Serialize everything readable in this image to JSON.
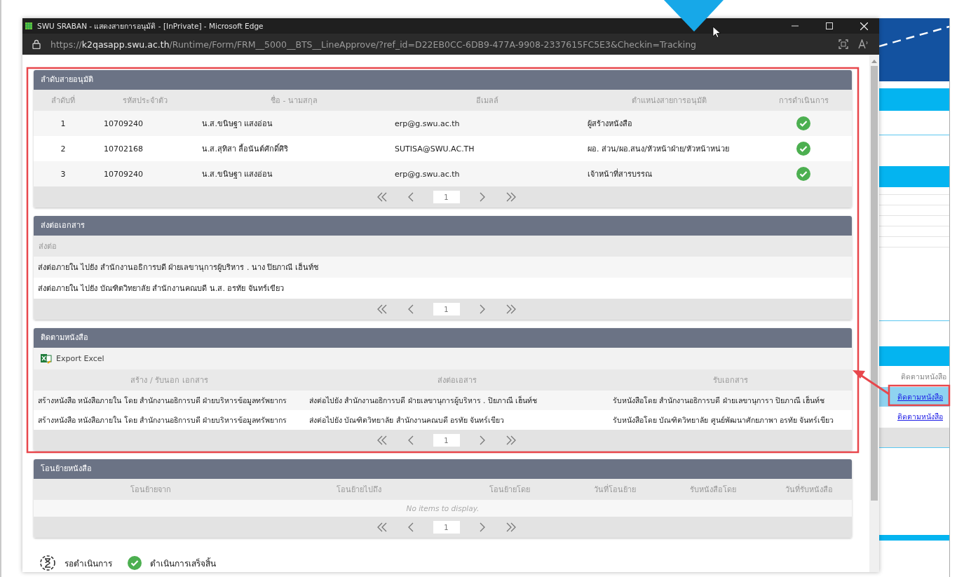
{
  "window": {
    "title": "SWU SRABAN - แสดงสายการอนุมัติ - [InPrivate] - Microsoft Edge",
    "url": {
      "scheme": "https://",
      "host": "k2qasapp.swu.ac.th",
      "path": "/Runtime/Form/FRM__5000__BTS__LineApprove/?ref_id=D22EB0CC-6DB9-477A-9908-2337615FC5E3&Checkin=Tracking"
    }
  },
  "approval_line": {
    "title": "ลำดับสายอนุมัติ",
    "columns": [
      "ลำดับที่",
      "รหัสประจำตัว",
      "ชื่อ - นามสกุล",
      "อีเมลล์",
      "ตำแหน่งสายการอนุมัติ",
      "การดำเนินการ"
    ],
    "rows": [
      {
        "no": "1",
        "id": "10709240",
        "name": "น.ส.ขนิษฐา แสงอ่อน",
        "email": "erp@g.swu.ac.th",
        "position": "ผู้สร้างหนังสือ",
        "done": true
      },
      {
        "no": "2",
        "id": "10702168",
        "name": "น.ส.สุทิสา ลื้อนันต์ศักดิ์ศิริ",
        "email": "SUTISA@SWU.AC.TH",
        "position": "ผอ. ส่วน/ผอ.สนง/หัวหน้าฝ่าย/หัวหน้าหน่วย",
        "done": true
      },
      {
        "no": "3",
        "id": "10709240",
        "name": "น.ส.ขนิษฐา แสงอ่อน",
        "email": "erp@g.swu.ac.th",
        "position": "เจ้าหน้าที่สารบรรณ",
        "done": true
      }
    ],
    "page": "1"
  },
  "forwarding": {
    "title": "ส่งต่อเอกสาร",
    "column": "ส่งต่อ",
    "rows": [
      "ส่งต่อภายใน ไปยัง สำนักงานอธิการบดี ฝ่ายเลขานุการผู้บริหาร . นาง ปิยภาณี เฮ็นท์ช",
      "ส่งต่อภายใน ไปยัง บัณฑิตวิทยาลัย สำนักงานคณบดี น.ส. อรทัย จันทร์เขียว"
    ],
    "page": "1"
  },
  "tracking": {
    "title": "ติดตามหนังสือ",
    "export_label": "Export Excel",
    "columns": [
      "สร้าง / รับนอก เอกสาร",
      "ส่งต่อเอสาร",
      "รับเอกสาร"
    ],
    "rows": [
      [
        "สร้างหนังสือ หนังสือภายใน โดย สำนักงานอธิการบดี ฝ่ายบริหารข้อมูลทรัพยากร",
        "ส่งต่อไปยัง สำนักงานอธิการบดี ฝ่ายเลขานุการผู้บริหาร . ปิยภาณี เฮ็นท์ช",
        "รับหนังสือโดย สำนักงานอธิการบดี ฝ่ายเลขานุการา ปิยภาณี เฮ็นท์ช"
      ],
      [
        "สร้างหนังสือ หนังสือภายใน โดย สำนักงานอธิการบดี ฝ่ายบริหารข้อมูลทรัพยากร",
        "ส่งต่อไปยัง บัณฑิตวิทยาลัย สำนักงานคณบดี อรทัย จันทร์เขียว",
        "รับหนังสือโดย บัณฑิตวิทยาลัย ศูนย์พัฒนาศักยภาพา อรทัย จันทร์เขียว"
      ]
    ],
    "page": "1"
  },
  "transfer": {
    "title": "โอนย้ายหนังสือ",
    "columns": [
      "โอนย้ายจาก",
      "โอนย้ายไปถึง",
      "โอนย้ายโดย",
      "วันที่โอนย้าย",
      "รับหนังสือโดย",
      "วันที่รับหนังสือ"
    ],
    "empty_text": "No items to display.",
    "page": "1"
  },
  "legend": [
    {
      "kind": "pending",
      "label": "รอดำเนินการ"
    },
    {
      "kind": "done",
      "label": "ดำเนินการเสร็จสิ้น"
    }
  ],
  "background_page": {
    "column_header": "ติดตามหนังสือ",
    "links": [
      {
        "label": "ติดตามหนังสือ",
        "selected": true
      },
      {
        "label": "ติดตามหนังสือ",
        "selected": false
      }
    ]
  }
}
